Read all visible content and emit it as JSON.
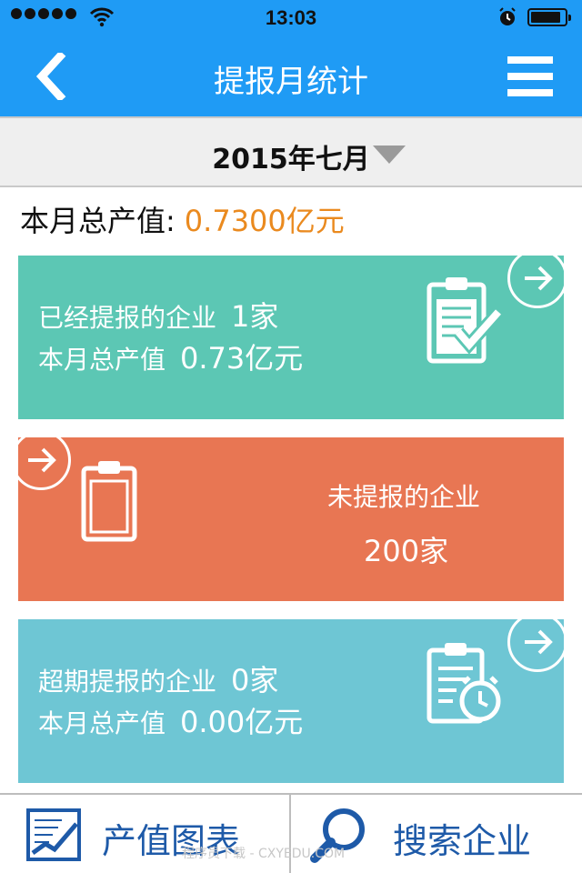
{
  "status_bar": {
    "time": "13:03"
  },
  "nav": {
    "title": "提报月统计",
    "back_icon": "chevron-left-icon",
    "menu_icon": "hamburger-menu-icon"
  },
  "month_selector": {
    "value": "2015年七月"
  },
  "summary": {
    "label": "本月总产值:",
    "value": "0.7300亿元"
  },
  "cards": [
    {
      "line1_label": "已经提报的企业",
      "line1_value": "1家",
      "line2_label": "本月总产值",
      "line2_value": "0.73亿元",
      "color": "#5cc7b4",
      "icon": "clipboard-check-icon"
    },
    {
      "label": "未提报的企业",
      "value": "200家",
      "color": "#e87653",
      "icon": "clipboard-icon"
    },
    {
      "line1_label": "超期提报的企业",
      "line1_value": "0家",
      "line2_label": "本月总产值",
      "line2_value": "0.00亿元",
      "color": "#6ec6d4",
      "icon": "clipboard-alarm-icon"
    }
  ],
  "bottom_tabs": [
    {
      "label": "产值图表",
      "icon": "chart-icon"
    },
    {
      "label": "搜索企业",
      "icon": "search-icon"
    }
  ],
  "watermark": "程序员下载 - CXYEDU.COM",
  "colors": {
    "primary": "#1f9bf5",
    "accent_orange": "#ea8a1f",
    "tab_text": "#1e5aa8"
  }
}
